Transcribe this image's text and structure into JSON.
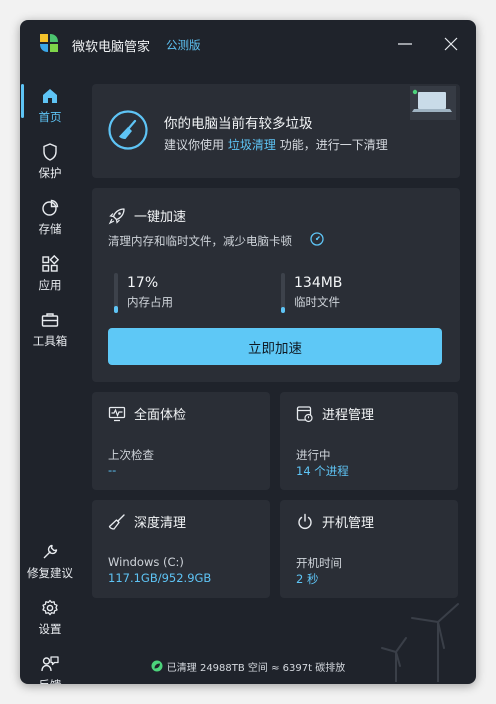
{
  "app": {
    "title": "微软电脑管家",
    "badge": "公测版"
  },
  "nav": {
    "items": [
      {
        "label": "首页",
        "icon": "home-icon",
        "active": true
      },
      {
        "label": "保护",
        "icon": "shield-icon"
      },
      {
        "label": "存储",
        "icon": "pie-chart-icon"
      },
      {
        "label": "应用",
        "icon": "apps-grid-icon"
      },
      {
        "label": "工具箱",
        "icon": "toolbox-icon"
      }
    ],
    "bottom": [
      {
        "label": "修复建议",
        "icon": "wrench-icon"
      },
      {
        "label": "设置",
        "icon": "gear-icon"
      },
      {
        "label": "反馈",
        "icon": "feedback-icon"
      }
    ]
  },
  "banner": {
    "title": "你的电脑当前有较多垃圾",
    "sub_before": "建议你使用",
    "sub_link": "垃圾清理",
    "sub_after": "功能，进行一下清理"
  },
  "boost": {
    "title": "一键加速",
    "desc": "清理内存和临时文件，减少电脑卡顿",
    "memory": {
      "value": "17%",
      "label": "内存占用",
      "fill": 0.17
    },
    "temp": {
      "value": "134MB",
      "label": "临时文件",
      "fill": 0.1
    },
    "button": "立即加速"
  },
  "tiles": {
    "checkup": {
      "title": "全面体检",
      "key": "上次检查",
      "value": "--"
    },
    "process": {
      "title": "进程管理",
      "key": "进行中",
      "value": "14 个进程"
    },
    "clean": {
      "title": "深度清理",
      "key": "Windows (C:)",
      "value": "117.1GB/952.9GB"
    },
    "startup": {
      "title": "开机管理",
      "key": "开机时间",
      "value": "2 秒"
    }
  },
  "footer": {
    "text": "已清理 24988TB 空间 ≈ 6397t 碳排放"
  },
  "colors": {
    "accent": "#5ec4f5",
    "window_bg": "#1f232b",
    "card_bg": "#2a2e36",
    "eco_green": "#4cd37b"
  }
}
